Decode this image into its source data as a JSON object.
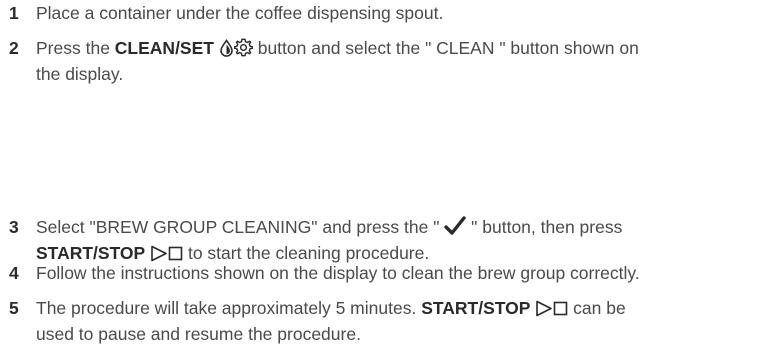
{
  "steps": [
    {
      "number": "1",
      "text": "Place a container under the coffee dispensing spout."
    },
    {
      "number": "2",
      "pre": "Press the ",
      "bold": "CLEAN/SET",
      "mid": " button and select the \" CLEAN \" button shown on",
      "line2": "the display.",
      "icons": [
        "water-drop-icon",
        "gear-icon"
      ]
    },
    {
      "number": "3",
      "pre": "Select \"BREW GROUP CLEANING\" and press the \" ",
      "post": " \" button, then press",
      "bold": "START/STOP",
      "line2_post": " to start the cleaning procedure.",
      "icons": [
        "checkmark-icon",
        "play-icon",
        "stop-icon"
      ]
    },
    {
      "number": "4",
      "text": "Follow the instructions shown on the display to clean the brew group correctly."
    },
    {
      "number": "5",
      "pre": "The procedure will take approximately 5 minutes. ",
      "bold": "START/STOP",
      "post": " can be",
      "line2": "used to pause and resume the procedure.",
      "icons": [
        "play-icon",
        "stop-icon"
      ]
    }
  ]
}
